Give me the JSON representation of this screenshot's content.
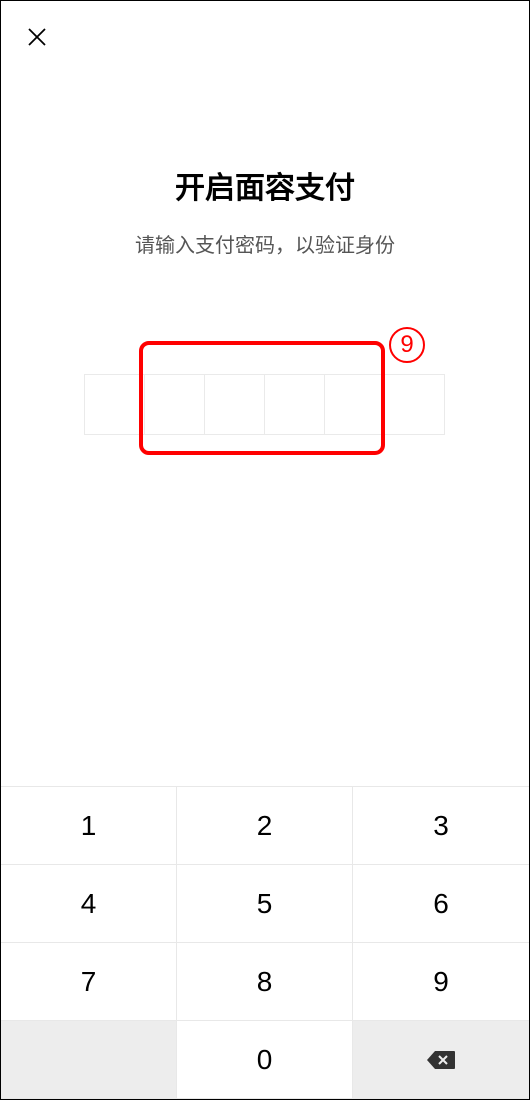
{
  "header": {
    "title": "开启面容支付",
    "subtitle": "请输入支付密码，以验证身份"
  },
  "annotation": {
    "number": "9"
  },
  "keypad": {
    "keys": [
      "1",
      "2",
      "3",
      "4",
      "5",
      "6",
      "7",
      "8",
      "9",
      "",
      "0",
      ""
    ]
  }
}
